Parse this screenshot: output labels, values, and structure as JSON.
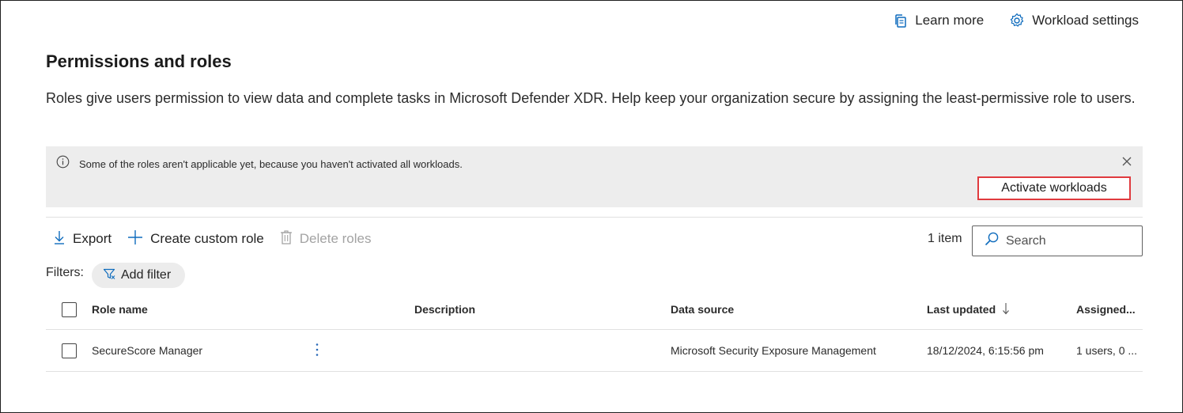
{
  "header": {
    "learn_more": "Learn more",
    "workload_settings": "Workload settings"
  },
  "page": {
    "title": "Permissions and roles",
    "description": "Roles give users permission to view data and complete tasks in Microsoft Defender XDR. Help keep your organization secure by assigning the least-permissive role to users."
  },
  "banner": {
    "message": "Some of the roles aren't applicable yet, because you haven't activated all workloads.",
    "action_label": "Activate workloads"
  },
  "toolbar": {
    "export": "Export",
    "create_custom_role": "Create custom role",
    "delete_roles": "Delete roles",
    "item_count": "1 item",
    "search_placeholder": "Search"
  },
  "filters": {
    "label": "Filters:",
    "add_filter": "Add filter"
  },
  "table": {
    "columns": {
      "role_name": "Role name",
      "description": "Description",
      "data_source": "Data source",
      "last_updated": "Last updated",
      "assigned": "Assigned..."
    },
    "rows": [
      {
        "role_name": "SecureScore Manager",
        "description": "",
        "data_source": "Microsoft Security Exposure Management",
        "last_updated": "18/12/2024, 6:15:56 pm",
        "assigned": "1 users, 0 ..."
      }
    ]
  },
  "icons": {
    "learn_more": "book-icon",
    "workload_settings": "gear-icon",
    "info": "info-icon",
    "close": "close-icon",
    "export": "download-arrow-icon",
    "create": "plus-icon",
    "delete": "trash-icon",
    "search": "search-icon",
    "filter": "filter-icon",
    "sort": "sort-down-arrow-icon",
    "more": "more-vertical-icon"
  },
  "colors": {
    "accent": "#0f6cbd",
    "highlight_border": "#e03a3e",
    "banner_bg": "#ededed"
  }
}
